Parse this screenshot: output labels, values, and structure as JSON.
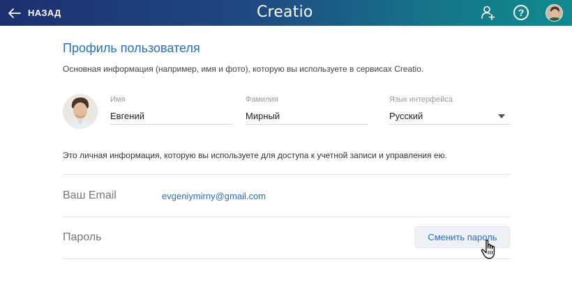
{
  "topbar": {
    "back_label": "НАЗАД",
    "logo": "Creatio",
    "help_glyph": "?"
  },
  "profile": {
    "title": "Профиль пользователя",
    "subtitle": "Основная информация (например, имя и фото), которую вы используете в сервисах Creatio.",
    "fields": {
      "first_name": {
        "label": "Имя",
        "value": "Евгений"
      },
      "last_name": {
        "label": "Фамилия",
        "value": "Мирный"
      },
      "language": {
        "label": "Язык интерфейса",
        "value": "Русский"
      }
    },
    "account_info": "Это личная информация, которую вы используете для доступа к учетной записи и управления ею.",
    "email": {
      "label": "Ваш Email",
      "value": "evgeniymirny@gmail.com"
    },
    "password": {
      "label": "Пароль",
      "button": "Сменить пароль"
    }
  },
  "colors": {
    "accent": "#2b6fbf",
    "topbar_start": "#1d2f6f",
    "topbar_end": "#0f8a8e"
  }
}
